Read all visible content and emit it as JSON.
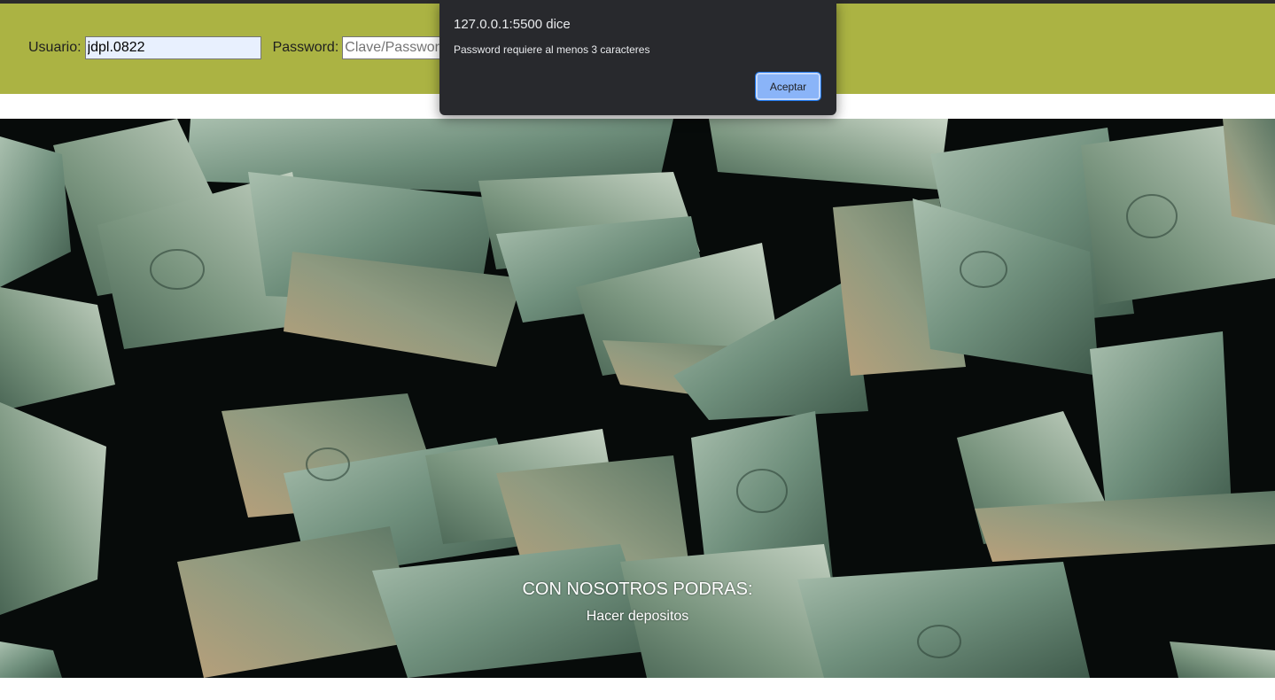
{
  "login": {
    "user_label": "Usuario:",
    "user_value": "jdpl.0822",
    "password_label": "Password:",
    "password_placeholder": "Clave/Password"
  },
  "banner": {
    "title": "CON NOSOTROS PODRAS:",
    "subtitle": "Hacer depositos",
    "image_description_icon": "falling-money-image"
  },
  "alert": {
    "title": "127.0.0.1:5500 dice",
    "message": "Password requiere al menos 3 caracteres",
    "ok_label": "Aceptar"
  },
  "colors": {
    "header_bg": "#abb343",
    "dialog_bg": "#28292d",
    "dialog_button": "#8ab4f8"
  }
}
